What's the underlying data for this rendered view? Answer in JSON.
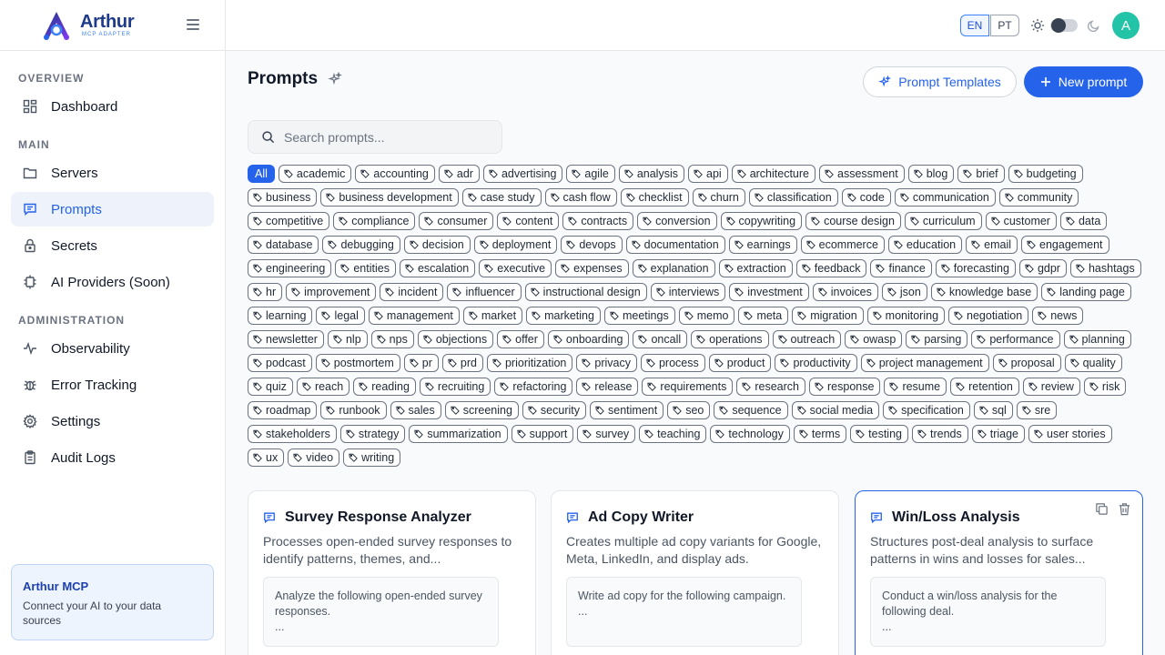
{
  "brand": {
    "name": "Arthur",
    "subtitle": "MCP ADAPTER"
  },
  "sidebar": {
    "sections": [
      {
        "label": "OVERVIEW"
      },
      {
        "label": "MAIN"
      },
      {
        "label": "ADMINISTRATION"
      }
    ],
    "items": [
      {
        "label": "Dashboard",
        "icon": "dashboard-icon"
      },
      {
        "label": "Servers",
        "icon": "folder-icon"
      },
      {
        "label": "Prompts",
        "icon": "message-icon",
        "active": true
      },
      {
        "label": "Secrets",
        "icon": "lock-icon"
      },
      {
        "label": "AI Providers (Soon)",
        "icon": "cpu-icon"
      },
      {
        "label": "Observability",
        "icon": "activity-icon"
      },
      {
        "label": "Error Tracking",
        "icon": "bug-icon"
      },
      {
        "label": "Settings",
        "icon": "gear-icon"
      },
      {
        "label": "Audit Logs",
        "icon": "clipboard-icon"
      }
    ],
    "promo": {
      "title": "Arthur MCP",
      "text": "Connect your AI to your data sources"
    }
  },
  "topbar": {
    "languages": [
      "EN",
      "PT"
    ],
    "selected_language": "EN",
    "avatar_initial": "A",
    "accent": "#22c3a6"
  },
  "main": {
    "title": "Prompts",
    "templates_button": "Prompt Templates",
    "new_button": "New prompt",
    "search_placeholder": "Search prompts...",
    "all_tag": "All",
    "tags": [
      "academic",
      "accounting",
      "adr",
      "advertising",
      "agile",
      "analysis",
      "api",
      "architecture",
      "assessment",
      "blog",
      "brief",
      "budgeting",
      "business",
      "business development",
      "case study",
      "cash flow",
      "checklist",
      "churn",
      "classification",
      "code",
      "communication",
      "community",
      "competitive",
      "compliance",
      "consumer",
      "content",
      "contracts",
      "conversion",
      "copywriting",
      "course design",
      "curriculum",
      "customer",
      "data",
      "database",
      "debugging",
      "decision",
      "deployment",
      "devops",
      "documentation",
      "earnings",
      "ecommerce",
      "education",
      "email",
      "engagement",
      "engineering",
      "entities",
      "escalation",
      "executive",
      "expenses",
      "explanation",
      "extraction",
      "feedback",
      "finance",
      "forecasting",
      "gdpr",
      "hashtags",
      "hr",
      "improvement",
      "incident",
      "influencer",
      "instructional design",
      "interviews",
      "investment",
      "invoices",
      "json",
      "knowledge base",
      "landing page",
      "learning",
      "legal",
      "management",
      "market",
      "marketing",
      "meetings",
      "memo",
      "meta",
      "migration",
      "monitoring",
      "negotiation",
      "news",
      "newsletter",
      "nlp",
      "nps",
      "objections",
      "offer",
      "onboarding",
      "oncall",
      "operations",
      "outreach",
      "owasp",
      "parsing",
      "performance",
      "planning",
      "podcast",
      "postmortem",
      "pr",
      "prd",
      "prioritization",
      "privacy",
      "process",
      "product",
      "productivity",
      "project management",
      "proposal",
      "quality",
      "quiz",
      "reach",
      "reading",
      "recruiting",
      "refactoring",
      "release",
      "requirements",
      "research",
      "response",
      "resume",
      "retention",
      "review",
      "risk",
      "roadmap",
      "runbook",
      "sales",
      "screening",
      "security",
      "sentiment",
      "seo",
      "sequence",
      "social media",
      "specification",
      "sql",
      "sre",
      "stakeholders",
      "strategy",
      "summarization",
      "support",
      "survey",
      "teaching",
      "technology",
      "terms",
      "testing",
      "trends",
      "triage",
      "user stories",
      "ux",
      "video",
      "writing"
    ],
    "cards": [
      {
        "title": "Survey Response Analyzer",
        "description": "Processes open-ended survey responses to identify patterns, themes, and...",
        "snippet_line1": "Analyze the following open-ended survey responses.",
        "snippet_line2": "..."
      },
      {
        "title": "Ad Copy Writer",
        "description": "Creates multiple ad copy variants for Google, Meta, LinkedIn, and display ads.",
        "snippet_line1": "Write ad copy for the following campaign.",
        "snippet_line2": "..."
      },
      {
        "title": "Win/Loss Analysis",
        "description": "Structures post-deal analysis to surface patterns in wins and losses for sales...",
        "snippet_line1": "Conduct a win/loss analysis for the following deal.",
        "snippet_line2": "..."
      }
    ],
    "primary_color": "#2563eb"
  }
}
